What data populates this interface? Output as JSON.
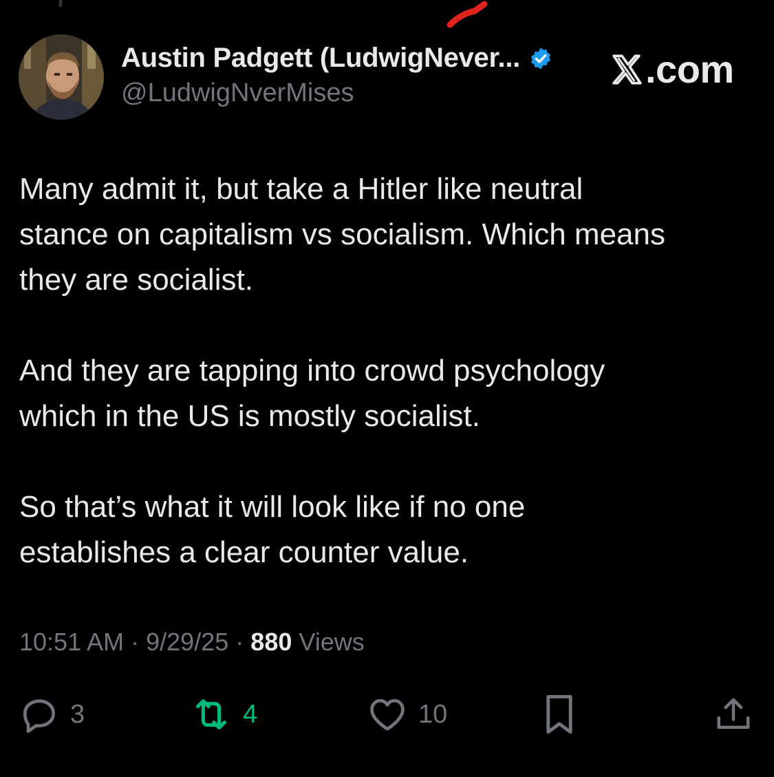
{
  "author": {
    "display_name": "Austin Padgett (LudwigNever...",
    "handle": "@LudwigNverMises",
    "verified": true
  },
  "brand": {
    "label": ".com",
    "icon": "x-logo-icon"
  },
  "tweet": {
    "paragraphs": [
      "Many admit it, but take a Hitler like neutral\nstance on capitalism vs socialism. Which means\nthey are socialist.",
      "And they are tapping into crowd psychology\nwhich in the US is mostly socialist.",
      "So that’s what it will look like if no one\nestablishes a clear counter value."
    ]
  },
  "meta": {
    "time": "10:51 AM",
    "separator": "·",
    "date": "9/29/25",
    "views_count": "880",
    "views_label": "Views"
  },
  "actions": {
    "reply_count": "3",
    "retweet_count": "4",
    "like_count": "10"
  },
  "colors": {
    "background": "#000000",
    "text_primary": "#e7e9ea",
    "text_secondary": "#71767b",
    "verified_blue": "#1d9bf0",
    "retweet_green": "#00ba7c",
    "annotation_red": "#e0241c"
  }
}
